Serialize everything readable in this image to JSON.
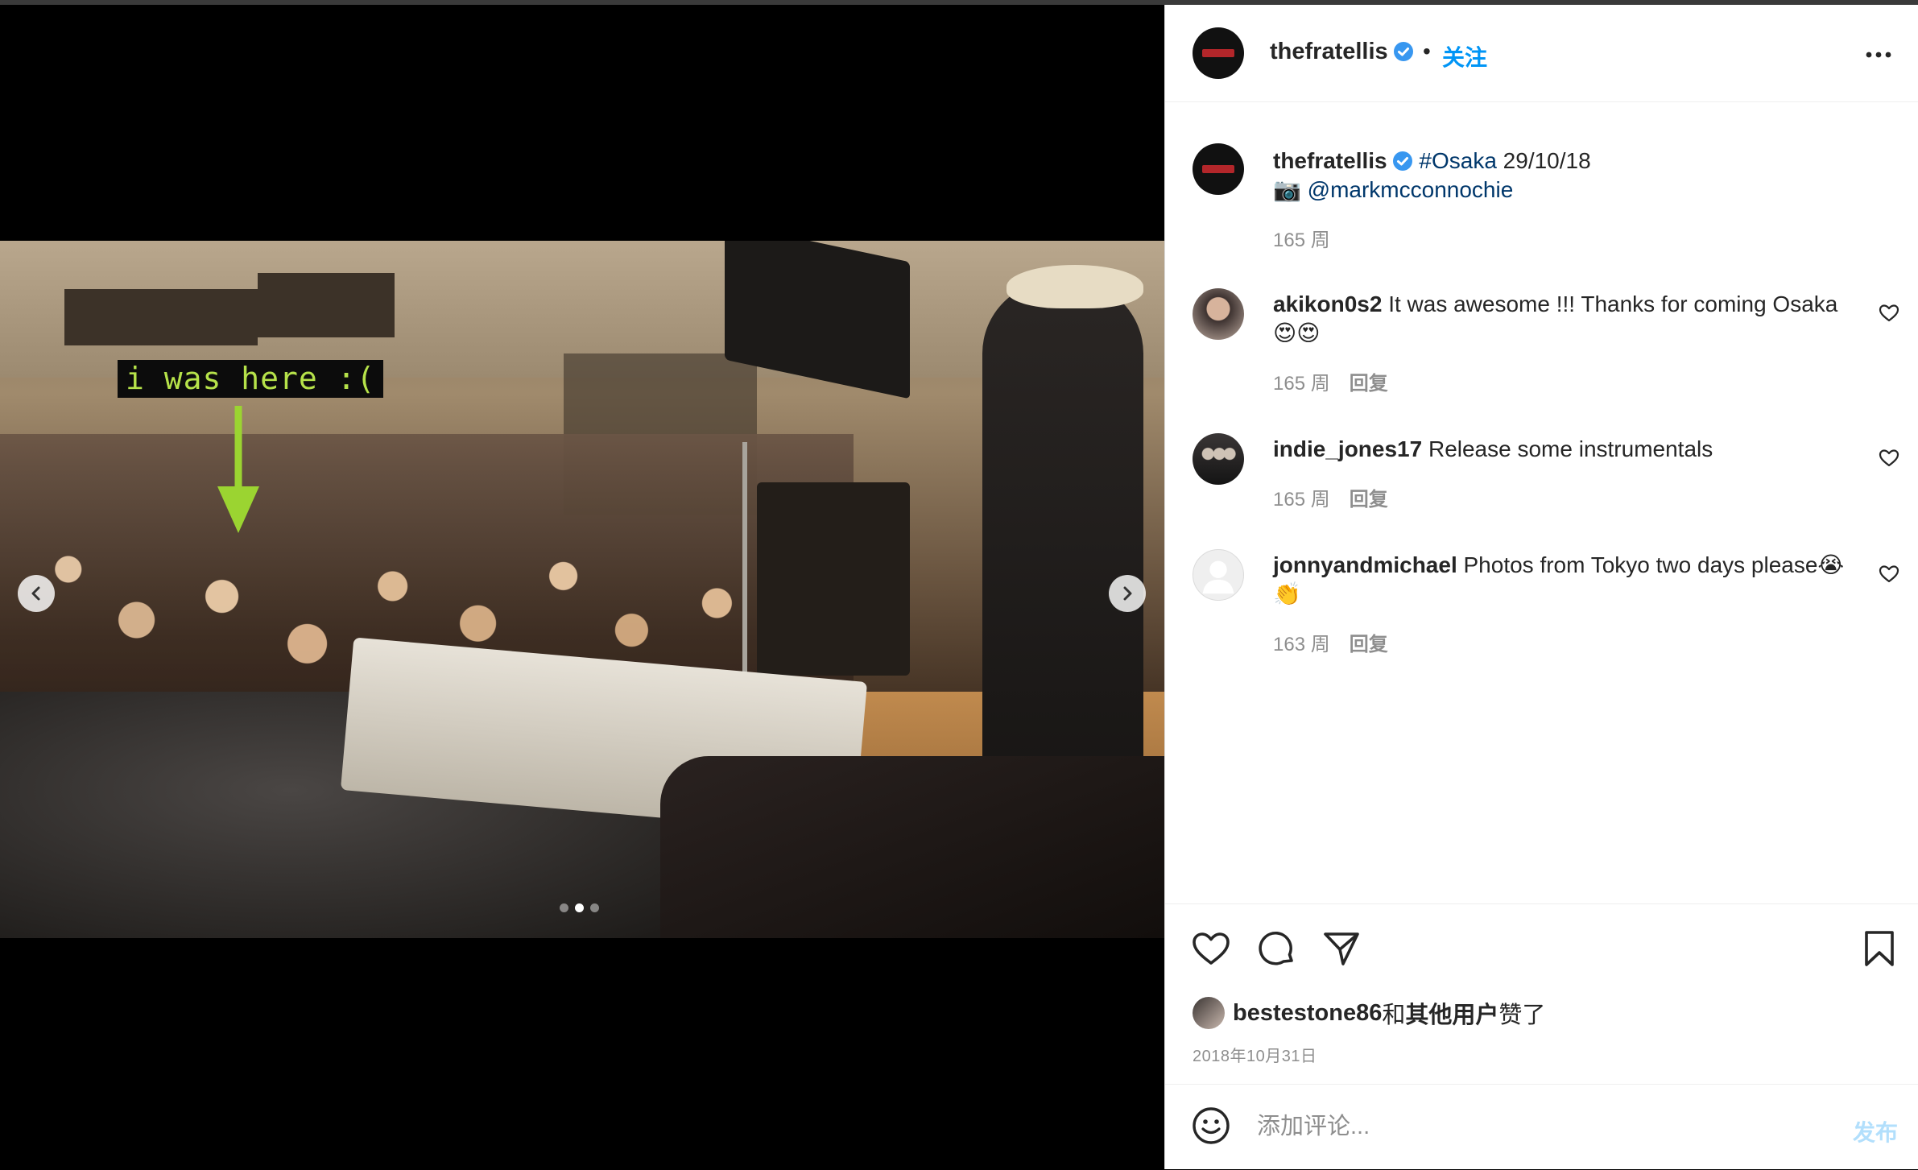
{
  "post": {
    "slide_count": 3,
    "active_slide": 2,
    "annotation_text": "i was here :("
  },
  "header": {
    "username": "thefratellis",
    "separator": "•",
    "follow_label": "关注"
  },
  "caption": {
    "username": "thefratellis",
    "hashtag": "#Osaka",
    "date_text": " 29/10/18",
    "camera_emoji": "📷 ",
    "mention": "@markmcconnochie",
    "time": "165 周"
  },
  "comments": [
    {
      "username": "akikon0s2",
      "text": " It was awesome !!! Thanks for coming Osaka 😍😍",
      "time": "165 周",
      "reply_label": "回复"
    },
    {
      "username": "indie_jones17",
      "text": " Release some instrumentals",
      "time": "165 周",
      "reply_label": "回复"
    },
    {
      "username": "jonnyandmichael",
      "text": " Photos from Tokyo two days please😭👏",
      "time": "163 周",
      "reply_label": "回复"
    }
  ],
  "likes": {
    "user": "bestestone86",
    "and": " 和 ",
    "others": "其他用户",
    "suffix": " 赞了"
  },
  "date": "2018年10月31日",
  "add_comment": {
    "placeholder": "添加评论...",
    "post_label": "发布"
  },
  "colors": {
    "accent": "#0095f6",
    "link": "#00376b",
    "annotation_green": "#b6e24a"
  }
}
